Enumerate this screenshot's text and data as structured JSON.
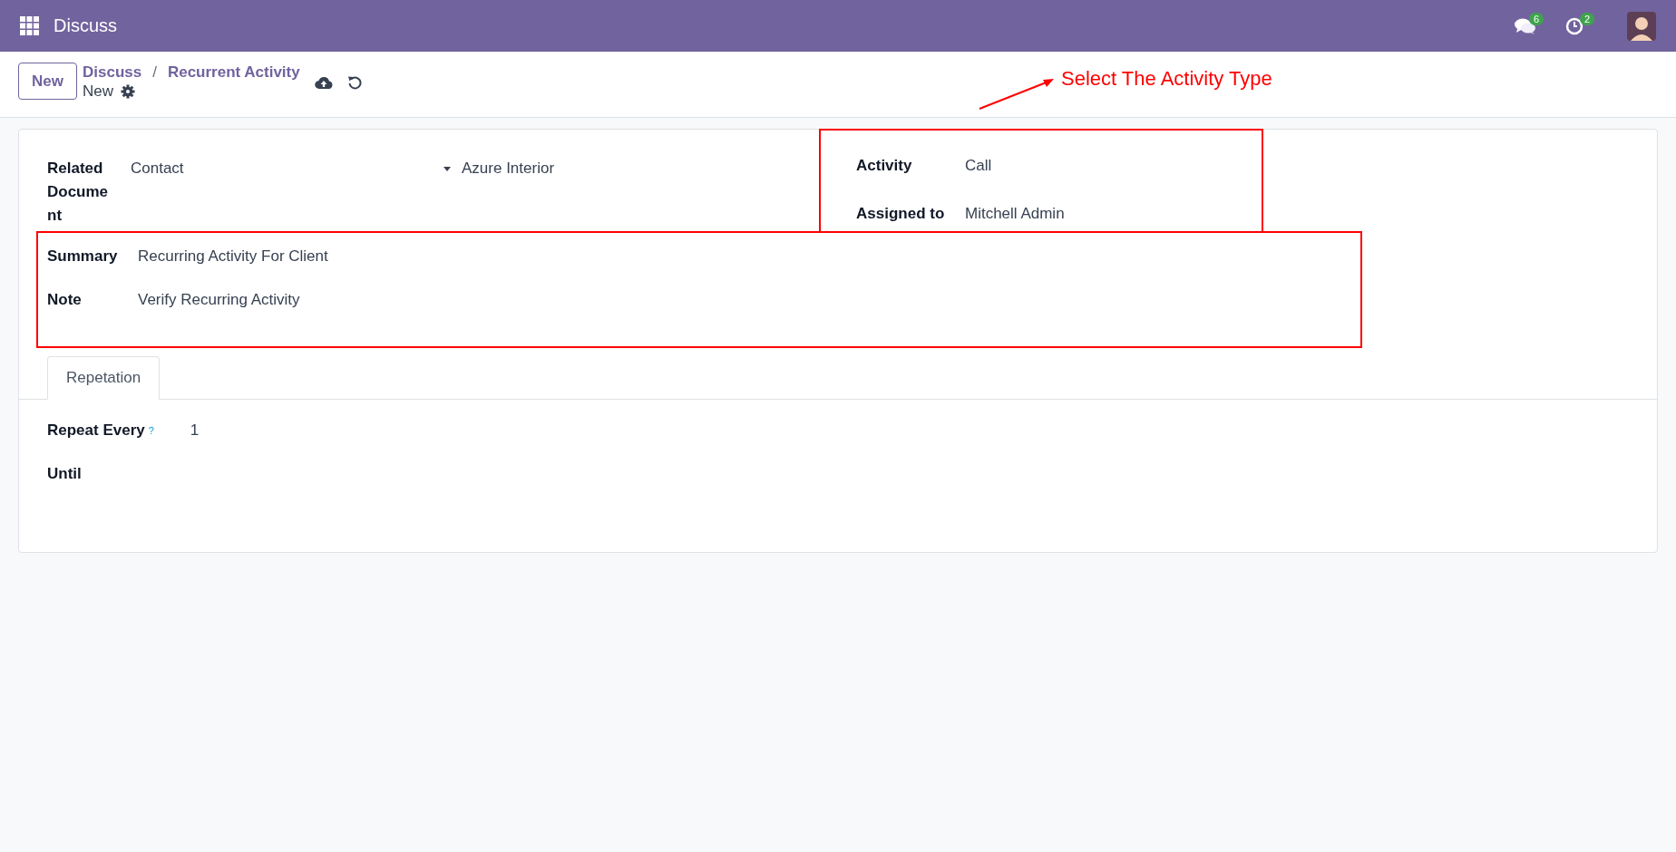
{
  "navbar": {
    "app_name": "Discuss",
    "messages_count": "6",
    "activities_count": "2"
  },
  "control_panel": {
    "new_button": "New",
    "breadcrumbs": [
      {
        "label": "Discuss"
      },
      {
        "label": "Recurrent Activity"
      }
    ],
    "separator": "/",
    "record_title": "New"
  },
  "form": {
    "related_document": {
      "label": "Related Document",
      "model": "Contact",
      "record": "Azure Interior"
    },
    "right_fields": [
      {
        "label": "Activity",
        "value": "Call"
      },
      {
        "label": "Assigned to",
        "value": "Mitchell Admin"
      }
    ],
    "wide_fields": [
      {
        "label": "Summary",
        "value": "Recurring Activity For Client"
      },
      {
        "label": "Note",
        "value": "Verify Recurring Activity"
      }
    ],
    "tabs": [
      {
        "label": "Repetation",
        "selected": true
      }
    ],
    "tab_fields": [
      {
        "label": "Repeat Every",
        "help": "?",
        "value": "1"
      },
      {
        "label": "Until"
      }
    ]
  },
  "annotation": {
    "text": "Select The Activity Type"
  }
}
